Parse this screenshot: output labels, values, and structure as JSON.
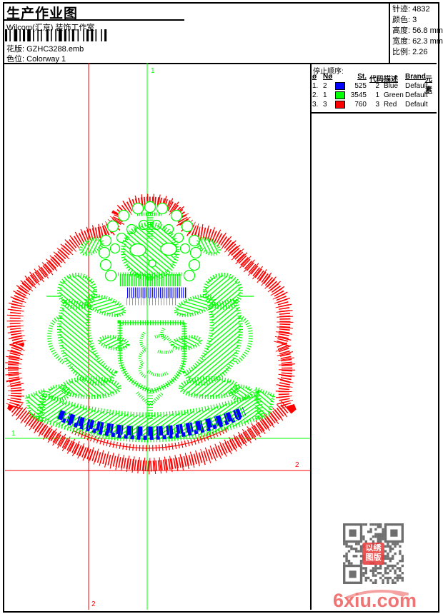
{
  "header": {
    "title": "生产作业图",
    "studio": "Wilcom(汇京) 装饰工作室",
    "pattern_label": "花版:",
    "pattern_value": "GZHC3288.emb",
    "colorway_label": "色位:",
    "colorway_value": "Colorway 1",
    "barcode_icon": "barcode"
  },
  "stats": {
    "stitches_label": "针迹:",
    "stitches": "4832",
    "colors_label": "颜色:",
    "colors": "3",
    "height_label": "高度:",
    "height": "56.8 mm",
    "width_label": "宽度:",
    "width": "62.3 mm",
    "scale_label": "比例:",
    "scale": "2.26"
  },
  "stop_sequence": {
    "title": "停止顺序:",
    "columns": [
      "ø",
      "Nø",
      "St.",
      "代码",
      "描述",
      "Brand",
      "元素"
    ],
    "rows": [
      {
        "index": "1.",
        "needle": "2",
        "swatch": "#0000ff",
        "st": "525",
        "code": "2",
        "desc": "Blue",
        "brand": "Default",
        "element": ""
      },
      {
        "index": "2.",
        "needle": "1",
        "swatch": "#00ff00",
        "st": "3545",
        "code": "1",
        "desc": "Green",
        "brand": "Default",
        "element": ""
      },
      {
        "index": "3.",
        "needle": "3",
        "swatch": "#ff0000",
        "st": "760",
        "code": "3",
        "desc": "Red",
        "brand": "Default",
        "element": ""
      }
    ]
  },
  "guides": {
    "green_color": "#00ff00",
    "red_color": "#ff0000",
    "green_vertical_label": "1",
    "green_horizontal_label": "1",
    "red_vertical_label": "2",
    "red_horizontal_label": "2"
  },
  "design": {
    "description": "coat-of-arms embroidery stitch preview",
    "border_color": "#ff0000",
    "fill_color": "#00ff00",
    "accent_color": "#0000ff"
  },
  "watermark": {
    "site": "6xiu.com",
    "qr_logo_line1": "以绣",
    "qr_logo_line2": "图版"
  }
}
